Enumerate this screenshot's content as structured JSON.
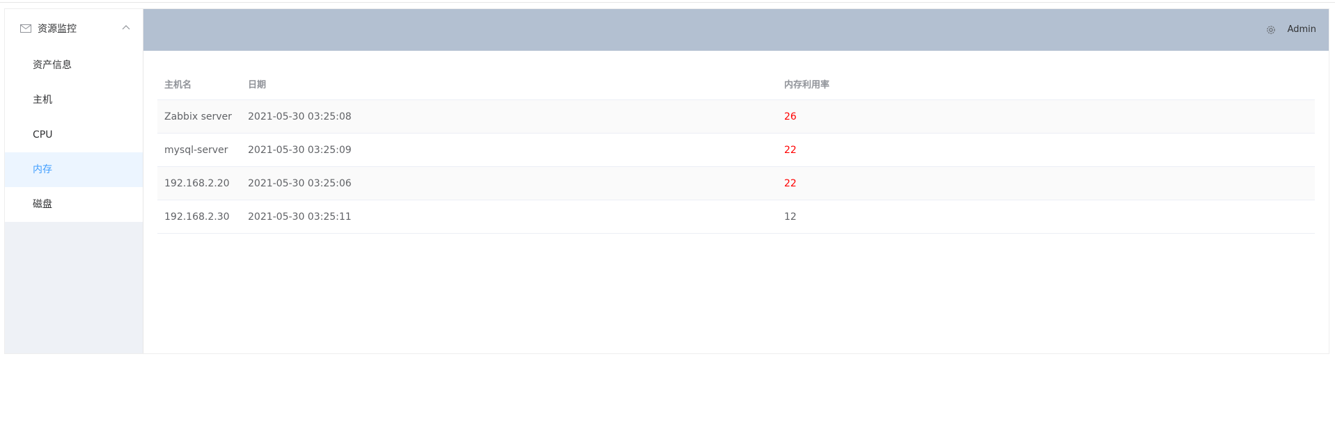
{
  "sidebar": {
    "submenu_title": "资源监控",
    "items": [
      {
        "label": "资产信息",
        "active": false
      },
      {
        "label": "主机",
        "active": false
      },
      {
        "label": "CPU",
        "active": false
      },
      {
        "label": "内存",
        "active": true
      },
      {
        "label": "磁盘",
        "active": false
      }
    ],
    "icons": {
      "submenu": "mail-icon",
      "toggle": "chevron-up-icon"
    }
  },
  "header": {
    "settings_icon": "gear-icon",
    "user_name": "Admin",
    "background_color": "#b3c0d1"
  },
  "table": {
    "columns": [
      "主机名",
      "日期",
      "内存利用率"
    ],
    "rows": [
      {
        "host": "Zabbix server",
        "date": "2021-05-30 03:25:08",
        "usage": "26",
        "highlight": true
      },
      {
        "host": "mysql-server",
        "date": "2021-05-30 03:25:09",
        "usage": "22",
        "highlight": true
      },
      {
        "host": "192.168.2.20",
        "date": "2021-05-30 03:25:06",
        "usage": "22",
        "highlight": true
      },
      {
        "host": "192.168.2.30",
        "date": "2021-05-30 03:25:11",
        "usage": "12",
        "highlight": false
      }
    ],
    "highlight_color": "#ff0000"
  },
  "colors": {
    "accent": "#409eff",
    "active_bg": "#ecf5ff",
    "sidebar_bg": "#eef1f6"
  }
}
